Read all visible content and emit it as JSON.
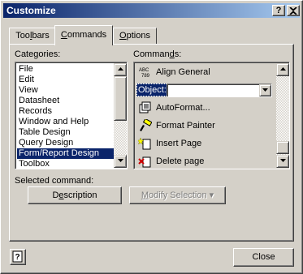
{
  "window": {
    "title": "Customize",
    "help_button": "?",
    "close_button": "X"
  },
  "tabs": [
    {
      "label": "Toolbars",
      "mnemonic_index": 3
    },
    {
      "label": "Commands",
      "mnemonic_index": 0
    },
    {
      "label": "Options",
      "mnemonic_index": 0
    }
  ],
  "categories": {
    "label": "Categories:",
    "items": [
      {
        "label": "File",
        "selected": false
      },
      {
        "label": "Edit",
        "selected": false
      },
      {
        "label": "View",
        "selected": false
      },
      {
        "label": "Datasheet",
        "selected": false
      },
      {
        "label": "Records",
        "selected": false
      },
      {
        "label": "Window and Help",
        "selected": false
      },
      {
        "label": "Table Design",
        "selected": false
      },
      {
        "label": "Query Design",
        "selected": false
      },
      {
        "label": "Form/Report Design",
        "selected": true
      },
      {
        "label": "Toolbox",
        "selected": false
      }
    ]
  },
  "commands": {
    "label": "Commands:",
    "items": [
      {
        "label": "Align General",
        "icon": "abc-789-icon"
      },
      {
        "label": "Object:",
        "type": "combo",
        "value": ""
      },
      {
        "label": "AutoFormat...",
        "icon": "autoformat-icon"
      },
      {
        "label": "Format Painter",
        "icon": "paintbrush-icon"
      },
      {
        "label": "Insert Page",
        "icon": "insert-page-icon"
      },
      {
        "label": "Delete page",
        "icon": "delete-page-icon"
      }
    ]
  },
  "selected_command": {
    "label": "Selected command:",
    "description_button": "Description",
    "modify_button": "Modify Selection",
    "modify_enabled": false
  },
  "footer": {
    "help_icon": "help-book-icon",
    "close_button": "Close"
  },
  "colors": {
    "face": "#d4d0c8",
    "titlebar_start": "#0a246a",
    "titlebar_end": "#a6caf0",
    "selection": "#0a246a"
  }
}
